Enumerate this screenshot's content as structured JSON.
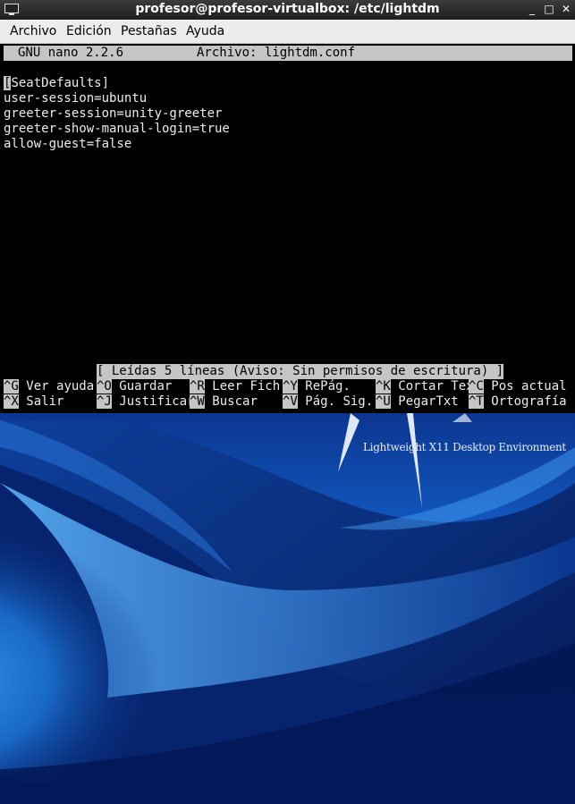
{
  "window": {
    "title": "profesor@profesor-virtualbox: /etc/lightdm",
    "minimize_glyph": "_",
    "maximize_glyph": "□",
    "close_glyph": "✕",
    "icon": "terminal-icon"
  },
  "menubar": {
    "items": [
      "Archivo",
      "Edición",
      "Pestañas",
      "Ayuda"
    ]
  },
  "nano": {
    "header_version": "GNU nano 2.2.6",
    "header_file": "Archivo: lightdm.conf",
    "cursor_char": "[",
    "lines": [
      "SeatDefaults]",
      "user-session=ubuntu",
      "greeter-session=unity-greeter",
      "greeter-show-manual-login=true",
      "allow-guest=false"
    ],
    "status": "[ Leídas 5 líneas (Aviso: Sin permisos de escritura) ]",
    "shortcuts_row1": [
      {
        "key": "^G",
        "label": "Ver ayuda"
      },
      {
        "key": "^O",
        "label": "Guardar"
      },
      {
        "key": "^R",
        "label": "Leer Fich"
      },
      {
        "key": "^Y",
        "label": "RePág."
      },
      {
        "key": "^K",
        "label": "Cortar Tex"
      },
      {
        "key": "^C",
        "label": "Pos actual"
      }
    ],
    "shortcuts_row2": [
      {
        "key": "^X",
        "label": "Salir"
      },
      {
        "key": "^J",
        "label": "Justificar"
      },
      {
        "key": "^W",
        "label": "Buscar"
      },
      {
        "key": "^V",
        "label": "Pág. Sig."
      },
      {
        "key": "^U",
        "label": "PegarTxt"
      },
      {
        "key": "^T",
        "label": "Ortografía"
      }
    ]
  },
  "desktop": {
    "wallpaper_text": "Lightweight X11 Desktop Environment",
    "colors": {
      "terminal_bg": "#000000",
      "highlight": "#c5c5c5",
      "wallpaper_dark": "#03164a",
      "wallpaper_light": "#2f8fe0"
    }
  }
}
